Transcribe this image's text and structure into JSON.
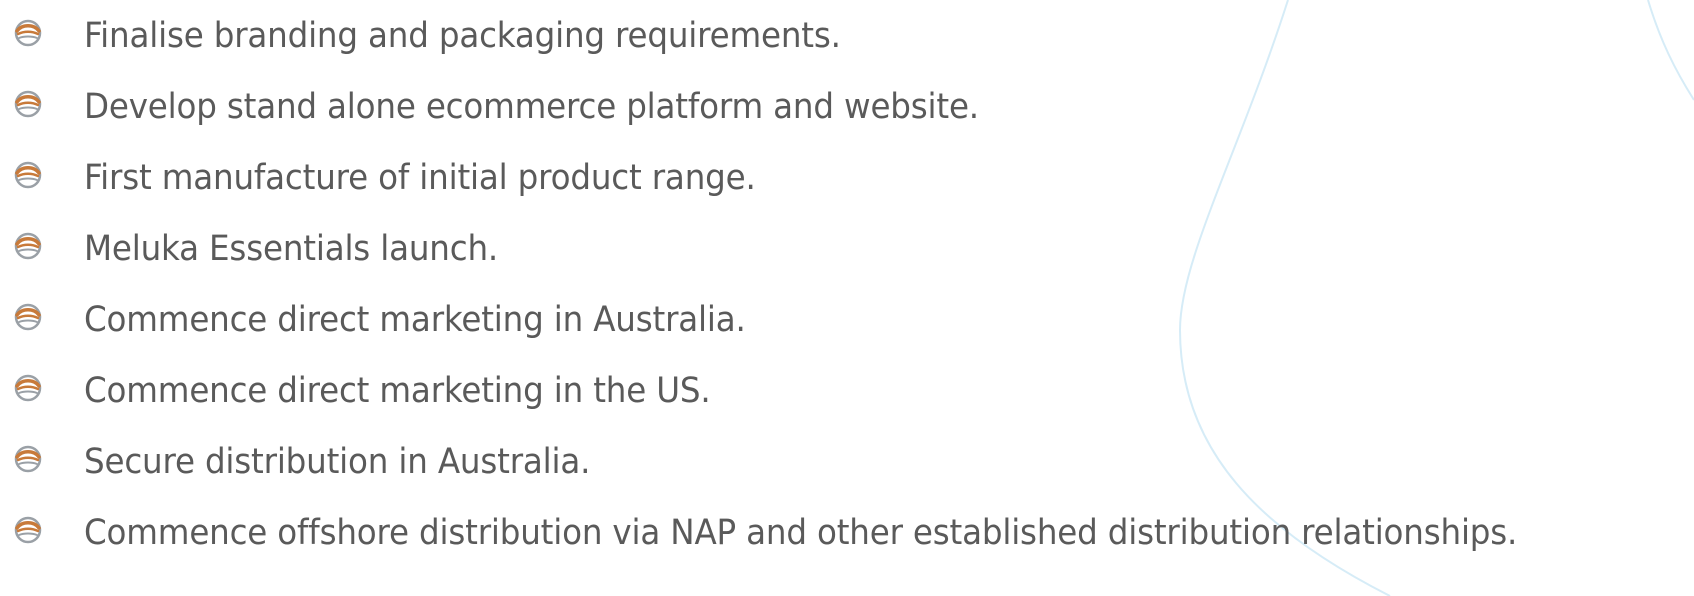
{
  "list": {
    "items": [
      "Finalise branding and packaging requirements.",
      "Develop stand alone ecommerce platform and website.",
      "First manufacture of initial product range.",
      "Meluka Essentials launch.",
      "Commence direct marketing in Australia.",
      "Commence direct marketing in the US.",
      "Secure distribution in Australia.",
      "Commence offshore distribution via NAP and other established distribution relationships."
    ]
  },
  "icons": {
    "bullet": "meluka-logo-icon"
  },
  "colors": {
    "text": "#5a5a5a",
    "bullet_top": "#c87a3a",
    "bullet_bottom": "#9aa0a6",
    "drop_outline": "#d6ecf7"
  }
}
